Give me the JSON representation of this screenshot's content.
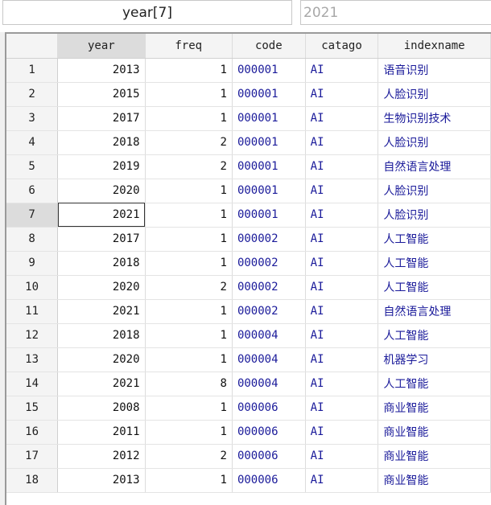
{
  "toolbar": {
    "varname": "year[7]",
    "value": "2021"
  },
  "columns": [
    "year",
    "freq",
    "code",
    "catago",
    "indexname"
  ],
  "selected_row": 7,
  "rows": [
    {
      "n": "1",
      "year": "2013",
      "freq": "1",
      "code": "000001",
      "catago": "AI",
      "indexname": "语音识别"
    },
    {
      "n": "2",
      "year": "2015",
      "freq": "1",
      "code": "000001",
      "catago": "AI",
      "indexname": "人脸识别"
    },
    {
      "n": "3",
      "year": "2017",
      "freq": "1",
      "code": "000001",
      "catago": "AI",
      "indexname": "生物识别技术"
    },
    {
      "n": "4",
      "year": "2018",
      "freq": "2",
      "code": "000001",
      "catago": "AI",
      "indexname": "人脸识别"
    },
    {
      "n": "5",
      "year": "2019",
      "freq": "2",
      "code": "000001",
      "catago": "AI",
      "indexname": "自然语言处理"
    },
    {
      "n": "6",
      "year": "2020",
      "freq": "1",
      "code": "000001",
      "catago": "AI",
      "indexname": "人脸识别"
    },
    {
      "n": "7",
      "year": "2021",
      "freq": "1",
      "code": "000001",
      "catago": "AI",
      "indexname": "人脸识别"
    },
    {
      "n": "8",
      "year": "2017",
      "freq": "1",
      "code": "000002",
      "catago": "AI",
      "indexname": "人工智能"
    },
    {
      "n": "9",
      "year": "2018",
      "freq": "1",
      "code": "000002",
      "catago": "AI",
      "indexname": "人工智能"
    },
    {
      "n": "10",
      "year": "2020",
      "freq": "2",
      "code": "000002",
      "catago": "AI",
      "indexname": "人工智能"
    },
    {
      "n": "11",
      "year": "2021",
      "freq": "1",
      "code": "000002",
      "catago": "AI",
      "indexname": "自然语言处理"
    },
    {
      "n": "12",
      "year": "2018",
      "freq": "1",
      "code": "000004",
      "catago": "AI",
      "indexname": "人工智能"
    },
    {
      "n": "13",
      "year": "2020",
      "freq": "1",
      "code": "000004",
      "catago": "AI",
      "indexname": "机器学习"
    },
    {
      "n": "14",
      "year": "2021",
      "freq": "8",
      "code": "000004",
      "catago": "AI",
      "indexname": "人工智能"
    },
    {
      "n": "15",
      "year": "2008",
      "freq": "1",
      "code": "000006",
      "catago": "AI",
      "indexname": "商业智能"
    },
    {
      "n": "16",
      "year": "2011",
      "freq": "1",
      "code": "000006",
      "catago": "AI",
      "indexname": "商业智能"
    },
    {
      "n": "17",
      "year": "2012",
      "freq": "2",
      "code": "000006",
      "catago": "AI",
      "indexname": "商业智能"
    },
    {
      "n": "18",
      "year": "2013",
      "freq": "1",
      "code": "000006",
      "catago": "AI",
      "indexname": "商业智能"
    }
  ]
}
